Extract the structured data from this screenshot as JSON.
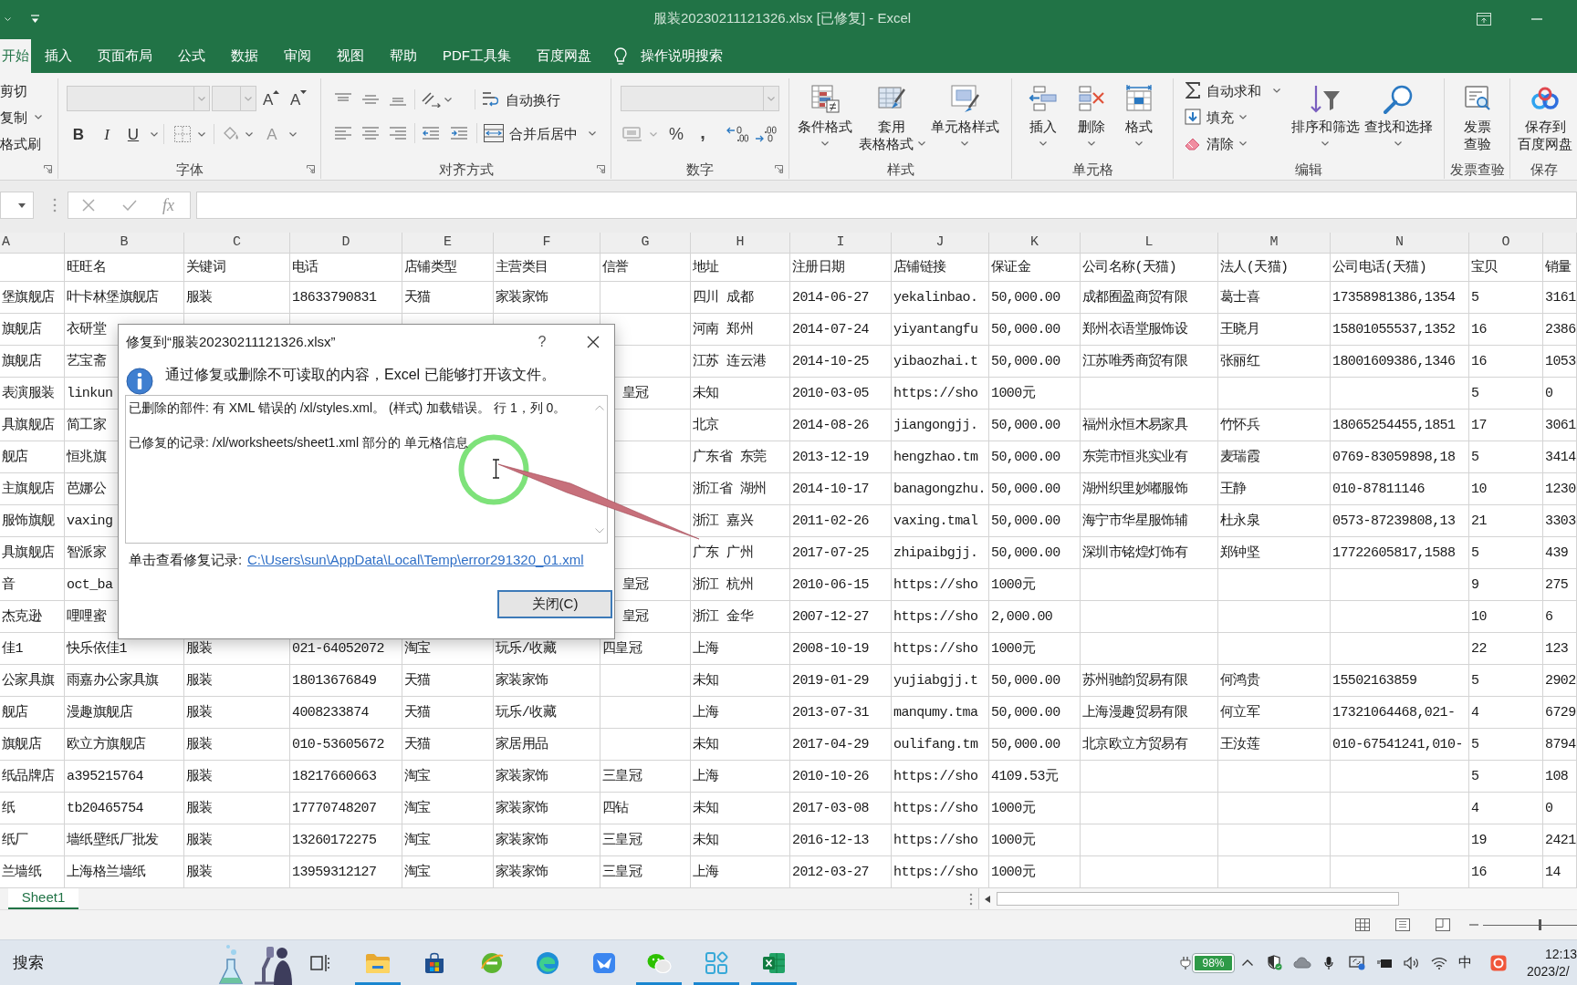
{
  "window": {
    "title": "服装20230211121326.xlsx [已修复] - Excel"
  },
  "tabs": [
    {
      "label": "开始",
      "selected": true
    },
    {
      "label": "插入",
      "selected": false
    },
    {
      "label": "页面布局",
      "selected": false
    },
    {
      "label": "公式",
      "selected": false
    },
    {
      "label": "数据",
      "selected": false
    },
    {
      "label": "审阅",
      "selected": false
    },
    {
      "label": "视图",
      "selected": false
    },
    {
      "label": "帮助",
      "selected": false
    },
    {
      "label": "PDF工具集",
      "selected": false
    },
    {
      "label": "百度网盘",
      "selected": false
    }
  ],
  "tell_me": "操作说明搜索",
  "ribbon": {
    "clipboard": [
      "剪切",
      "复制",
      "格式刷"
    ],
    "font": {
      "grow": "A",
      "shrink": "A",
      "toggles": [
        "B",
        "I",
        "U"
      ],
      "font_color": "A",
      "label": "字体"
    },
    "alignment": {
      "wrap": "自动换行",
      "merge": "合并后居中",
      "label": "对齐方式"
    },
    "number": {
      "percent": "%",
      "comma": ",",
      "label": "数字"
    },
    "styles": {
      "conditional": "条件格式",
      "table": [
        "套用",
        "表格格式"
      ],
      "cell": "单元格样式",
      "label": "样式"
    },
    "cells": {
      "buttons": [
        "插入",
        "删除",
        "格式"
      ],
      "label": "单元格"
    },
    "editing": {
      "autosum": "自动求和",
      "fill": "填充",
      "clear": "清除",
      "sort": "排序和筛选",
      "find": "查找和选择",
      "label": "编辑"
    },
    "invoice": {
      "button": [
        "发票",
        "查验"
      ],
      "label": "发票查验"
    },
    "save": {
      "button": [
        "保存到",
        "百度网盘"
      ],
      "label": "保存"
    }
  },
  "formula_bar": {
    "function_label": "fx"
  },
  "sheet": {
    "columns": [
      "A",
      "B",
      "C",
      "D",
      "E",
      "F",
      "G",
      "H",
      "I",
      "J",
      "K",
      "L",
      "M",
      "N",
      "O"
    ],
    "rows": [
      [
        null,
        "旺旺名",
        "关键词",
        "电话",
        "店铺类型",
        "主营类目",
        "信誉",
        "地址",
        "注册日期",
        "店铺链接",
        "保证金",
        "公司名称(天猫)",
        "法人(天猫)",
        "公司电话(天猫)",
        "宝贝",
        "销量"
      ],
      [
        "堡旗舰店",
        "叶卡林堡旗舰店",
        "服装",
        "18633790831",
        "天猫",
        "家装家饰",
        null,
        "四川 成都",
        "2014-06-27",
        "yekalinbao.",
        "50,000.00",
        "成都囿盈商贸有限",
        "葛士喜",
        "17358981386,1354",
        "5",
        "3161"
      ],
      [
        "旗舰店",
        "衣研堂",
        null,
        null,
        null,
        null,
        null,
        "河南 郑州",
        "2014-07-24",
        "yiyantangfu",
        "50,000.00",
        "郑州衣语堂服饰设",
        "王晓月",
        "15801055537,1352",
        "16",
        "2386"
      ],
      [
        "旗舰店",
        "艺宝斋",
        null,
        null,
        null,
        null,
        null,
        "江苏 连云港",
        "2014-10-25",
        "yibaozhai.t",
        "50,000.00",
        "江苏唯秀商贸有限",
        "张丽红",
        "18001609386,1346",
        "16",
        "1053"
      ],
      [
        "表演服装",
        "linkun",
        null,
        null,
        null,
        null,
        {
          "text": "皇冠",
          "clipped": true
        },
        "未知",
        "2010-03-05",
        "https://sho",
        "1000元",
        null,
        null,
        null,
        "5",
        "0"
      ],
      [
        "具旗舰店",
        "简工家",
        null,
        null,
        null,
        null,
        null,
        "北京",
        "2014-08-26",
        "jiangongjj.",
        "50,000.00",
        "福州永恒木易家具",
        "竹怀兵",
        "18065254455,1851",
        "17",
        "3061"
      ],
      [
        "舰店",
        "恒兆旗",
        null,
        null,
        null,
        null,
        null,
        "广东省 东莞",
        "2013-12-19",
        "hengzhao.tm",
        "50,000.00",
        "东莞市恒兆实业有",
        "麦瑞霞",
        "0769-83059898,18",
        "5",
        "3414"
      ],
      [
        "主旗舰店",
        "芭娜公",
        null,
        null,
        null,
        null,
        null,
        "浙江省 湖州",
        "2014-10-17",
        "banagongzhu.",
        "50,000.00",
        "湖州织里妙嘟服饰",
        "王静",
        "010-87811146",
        "10",
        "1230"
      ],
      [
        "服饰旗舰",
        "vaxing",
        null,
        null,
        null,
        null,
        null,
        "浙江 嘉兴",
        "2011-02-26",
        "vaxing.tmal",
        "50,000.00",
        "海宁市华星服饰辅",
        "杜永泉",
        "0573-87239808,13",
        "21",
        "3303"
      ],
      [
        "具旗舰店",
        "智派家",
        null,
        null,
        null,
        null,
        null,
        "广东 广州",
        "2017-07-25",
        "zhipaibgjj.",
        "50,000.00",
        "深圳市铭煌灯饰有",
        "郑钟坚",
        "17722605817,1588",
        "5",
        "439"
      ],
      [
        "音",
        "oct_ba",
        null,
        null,
        null,
        null,
        {
          "text": "皇冠",
          "clipped": true
        },
        "浙江 杭州",
        "2010-06-15",
        "https://sho",
        "1000元",
        null,
        null,
        null,
        "9",
        "275"
      ],
      [
        "杰克逊",
        "哩哩蜜",
        null,
        null,
        null,
        null,
        {
          "text": "皇冠",
          "clipped": true
        },
        "浙江 金华",
        "2007-12-27",
        "https://sho",
        "2,000.00",
        null,
        null,
        null,
        "10",
        "6"
      ],
      [
        "佳1",
        "快乐依佳1",
        "服装",
        "021-64052072",
        "淘宝",
        "玩乐/收藏",
        "四皇冠",
        "上海",
        "2008-10-19",
        "https://sho",
        "1000元",
        null,
        null,
        null,
        "22",
        "123"
      ],
      [
        "公家具旗",
        "雨嘉办公家具旗",
        "服装",
        "18013676849",
        "天猫",
        "家装家饰",
        null,
        "未知",
        "2019-01-29",
        "yujiabgjj.t",
        "50,000.00",
        "苏州驰韵贸易有限",
        "何鸿贵",
        "15502163859",
        "5",
        "2902"
      ],
      [
        "舰店",
        "漫趣旗舰店",
        "服装",
        "4008233874",
        "天猫",
        "玩乐/收藏",
        null,
        "上海",
        "2013-07-31",
        "manqumy.tma",
        "50,000.00",
        "上海漫趣贸易有限",
        "何立军",
        "17321064468,021-",
        "4",
        "6729"
      ],
      [
        "旗舰店",
        "欧立方旗舰店",
        "服装",
        "010-53605672",
        "天猫",
        "家居用品",
        null,
        "未知",
        "2017-04-29",
        "oulifang.tm",
        "50,000.00",
        "北京欧立方贸易有",
        "王汝莲",
        "010-67541241,010-",
        "5",
        "8794"
      ],
      [
        "纸品牌店",
        "a395215764",
        "服装",
        "18217660663",
        "淘宝",
        "家装家饰",
        "三皇冠",
        "上海",
        "2010-10-26",
        "https://sho",
        "4109.53元",
        null,
        null,
        null,
        "5",
        "108"
      ],
      [
        "纸",
        "tb20465754",
        "服装",
        "17770748207",
        "淘宝",
        "家装家饰",
        "四钻",
        "未知",
        "2017-03-08",
        "https://sho",
        "1000元",
        null,
        null,
        null,
        "4",
        "0"
      ],
      [
        "纸厂",
        "墙纸壁纸厂批发",
        "服装",
        "13260172275",
        "淘宝",
        "家装家饰",
        "三皇冠",
        "未知",
        "2016-12-13",
        "https://sho",
        "1000元",
        null,
        null,
        null,
        "19",
        "2421"
      ],
      [
        "兰墙纸",
        "上海格兰墙纸",
        "服装",
        "13959312127",
        "淘宝",
        "家装家饰",
        "三皇冠",
        "上海",
        "2012-03-27",
        "https://sho",
        "1000元",
        null,
        null,
        null,
        "16",
        "14"
      ]
    ]
  },
  "dialog": {
    "title": "修复到“服装20230211121326.xlsx”",
    "help": "?",
    "message": "通过修复或删除不可读取的内容，Excel 已能够打开该文件。",
    "details": [
      "已删除的部件: 有 XML 错误的 /xl/styles.xml。 (样式) 加载错误。 行 1，列 0。",
      "已修复的记录: /xl/worksheets/sheet1.xml 部分的 单元格信息"
    ],
    "log_label": "单击查看修复记录:",
    "log_link": "C:\\Users\\sun\\AppData\\Local\\Temp\\error291320_01.xml",
    "close_button": "关闭(C)"
  },
  "sheet_tabs": [
    {
      "label": "Sheet1",
      "selected": true
    }
  ],
  "status_bar": {
    "views": [
      {
        "kind": "normal"
      },
      {
        "kind": "page_layout"
      },
      {
        "kind": "page_break"
      }
    ],
    "zoom": {
      "level": 0.61
    }
  },
  "taskbar": {
    "search": "搜索",
    "apps": [
      {
        "kind": "task_view",
        "running": false
      },
      {
        "kind": "file_explorer",
        "running": true
      },
      {
        "kind": "store",
        "running": false
      },
      {
        "kind": "browser_e",
        "running": false
      },
      {
        "kind": "edge",
        "running": false
      },
      {
        "kind": "bird",
        "running": false
      },
      {
        "kind": "chat",
        "running": true
      },
      {
        "kind": "app_grid",
        "running": true
      },
      {
        "kind": "spreadsheet",
        "running": true
      }
    ],
    "tray": {
      "battery": "98%",
      "ime": "中",
      "time": "12:13",
      "date": "2023/2/"
    }
  }
}
